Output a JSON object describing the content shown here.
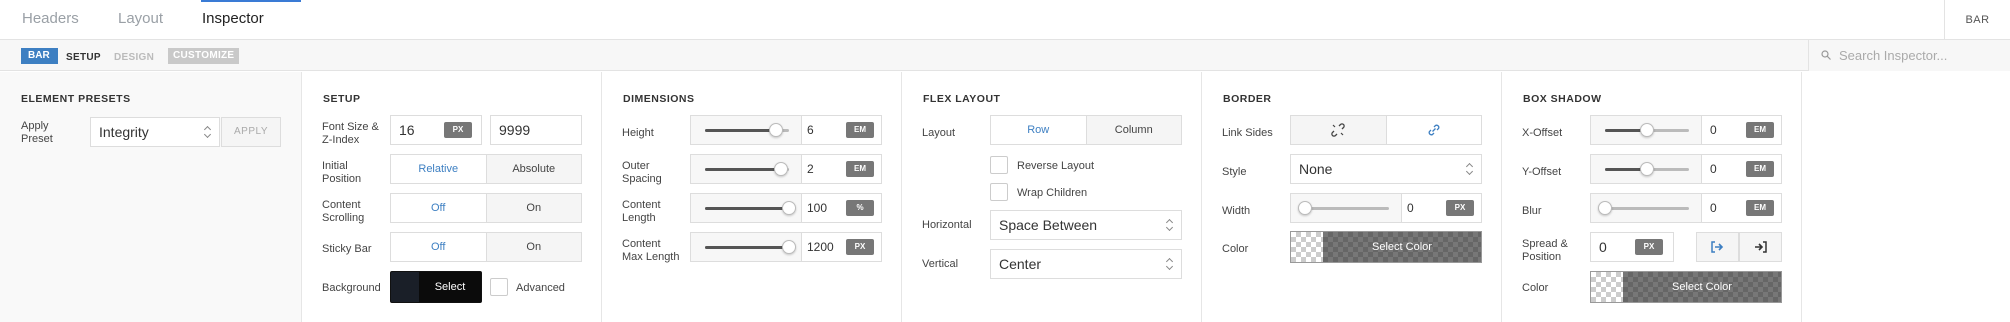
{
  "tabs": {
    "headers": "Headers",
    "layout": "Layout",
    "inspector": "Inspector"
  },
  "top_right": "BAR",
  "breadcrumb": {
    "bar": "BAR",
    "setup": "SETUP",
    "design": "DESIGN",
    "customize": "CUSTOMIZE"
  },
  "search": {
    "placeholder": "Search Inspector..."
  },
  "presets": {
    "title": "ELEMENT PRESETS",
    "apply_label": "Apply Preset",
    "preset_value": "Integrity",
    "apply_button": "APPLY"
  },
  "setup": {
    "title": "SETUP",
    "font_label": "Font Size & Z-Index",
    "font_size": "16",
    "font_unit": "PX",
    "z_index": "9999",
    "position_label": "Initial Position",
    "position_relative": "Relative",
    "position_absolute": "Absolute",
    "scrolling_label": "Content Scrolling",
    "scrolling_off": "Off",
    "scrolling_on": "On",
    "sticky_label": "Sticky Bar",
    "sticky_off": "Off",
    "sticky_on": "On",
    "bg_label": "Background",
    "bg_select": "Select",
    "advanced_label": "Advanced"
  },
  "dimensions": {
    "title": "DIMENSIONS",
    "height_label": "Height",
    "height_value": "6",
    "height_unit": "EM",
    "height_level": 0.85,
    "spacing_label": "Outer Spacing",
    "spacing_value": "2",
    "spacing_unit": "EM",
    "spacing_level": 0.9,
    "length_label": "Content Length",
    "length_value": "100",
    "length_unit": "%",
    "length_level": 1.0,
    "maxlength_label": "Content Max Length",
    "maxlength_value": "1200",
    "maxlength_unit": "PX",
    "maxlength_level": 1.0
  },
  "flex": {
    "title": "FLEX LAYOUT",
    "layout_label": "Layout",
    "row": "Row",
    "column": "Column",
    "reverse_label": "Reverse Layout",
    "wrap_label": "Wrap Children",
    "horizontal_label": "Horizontal",
    "horizontal_value": "Space Between",
    "vertical_label": "Vertical",
    "vertical_value": "Center"
  },
  "border": {
    "title": "BORDER",
    "link_label": "Link Sides",
    "style_label": "Style",
    "style_value": "None",
    "width_label": "Width",
    "width_value": "0",
    "width_unit": "PX",
    "color_label": "Color",
    "color_select": "Select Color"
  },
  "shadow": {
    "title": "BOX SHADOW",
    "xoff_label": "X-Offset",
    "xoff_value": "0",
    "xoff_unit": "EM",
    "xoff_level": 0.5,
    "yoff_label": "Y-Offset",
    "yoff_value": "0",
    "yoff_unit": "EM",
    "yoff_level": 0.5,
    "blur_label": "Blur",
    "blur_value": "0",
    "blur_unit": "EM",
    "blur_level": 0.0,
    "spread_label": "Spread & Position",
    "spread_value": "0",
    "spread_unit": "PX",
    "color_label": "Color",
    "color_select": "Select Color"
  },
  "colors": {
    "accent": "#3d7fc2",
    "dark": "#111111"
  },
  "icons": {
    "link_off": "unlink-icon",
    "link_on": "link-icon",
    "outset": "shadow-outset-icon",
    "inset": "shadow-inset-icon"
  }
}
